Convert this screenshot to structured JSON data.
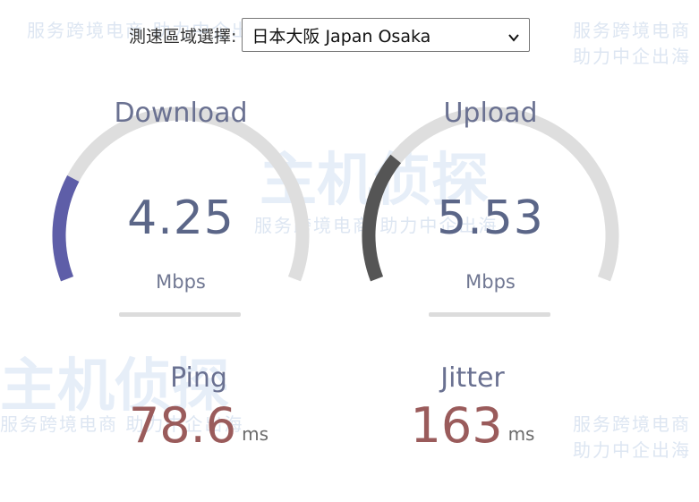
{
  "server": {
    "label": "測速區域選擇:",
    "selected": "日本大阪 Japan Osaka"
  },
  "download": {
    "title": "Download",
    "value": "4.25",
    "unit": "Mbps",
    "fill_fraction": 0.22,
    "color": "#5e5ea8"
  },
  "upload": {
    "title": "Upload",
    "value": "5.53",
    "unit": "Mbps",
    "fill_fraction": 0.27,
    "color": "#555555"
  },
  "ping": {
    "title": "Ping",
    "value": "78.6",
    "unit": "ms"
  },
  "jitter": {
    "title": "Jitter",
    "value": "163",
    "unit": "ms"
  },
  "watermark": {
    "brand": "主机侦探",
    "slogan": "服务跨境电商 助力中企出海"
  },
  "colors": {
    "track": "#dedede",
    "label": "#6a7191",
    "meter_value": "#9a5b5b"
  }
}
